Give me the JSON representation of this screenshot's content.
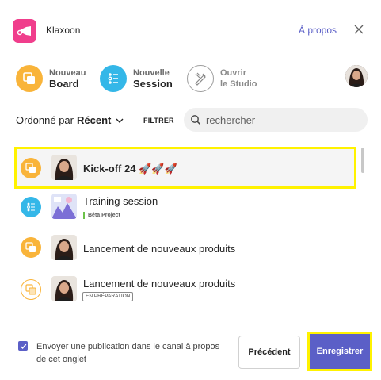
{
  "header": {
    "app_name": "Klaxoon",
    "about_link": "À propos",
    "close_icon": "close-icon",
    "brand_color": "#f03e8c"
  },
  "actions": [
    {
      "line1": "Nouveau",
      "line2": "Board",
      "icon": "board-icon",
      "color": "#f9b43a"
    },
    {
      "line1": "Nouvelle",
      "line2": "Session",
      "icon": "session-icon",
      "color": "#34b7e8"
    },
    {
      "line1": "Ouvrir",
      "line2": "le Studio",
      "icon": "studio-icon",
      "color": "#ffffff"
    }
  ],
  "toolbar": {
    "sort_prefix": "Ordonné par",
    "sort_value": "Récent",
    "filter_label": "FILTRER",
    "search_placeholder": "rechercher"
  },
  "list": {
    "items": [
      {
        "title": "Kick-off 24 🚀🚀🚀",
        "type": "board",
        "tag": "",
        "selected": true
      },
      {
        "title": "Training session",
        "type": "session",
        "tag": "Bêta Project",
        "selected": false
      },
      {
        "title": "Lancement de nouveaux produits",
        "type": "board",
        "tag": "",
        "selected": false
      },
      {
        "title": "Lancement de nouveaux produits",
        "type": "board-draft",
        "tag": "EN PRÉPARATION",
        "selected": false
      }
    ]
  },
  "footer": {
    "checkbox_checked": true,
    "notice": "Envoyer une publication dans le canal à propos de cet onglet",
    "prev_label": "Précédent",
    "save_label": "Enregistrer",
    "accent_color": "#5b5fc7"
  }
}
